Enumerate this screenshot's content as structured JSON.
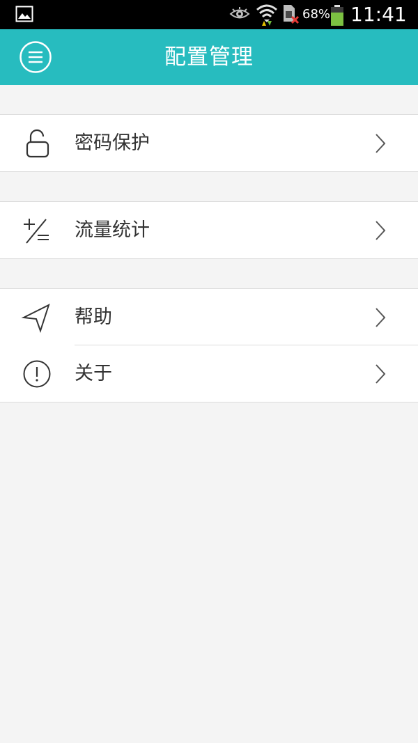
{
  "colors": {
    "accent": "#27bcbf",
    "background": "#f4f4f4",
    "status_bar": "#000000"
  },
  "status_bar": {
    "battery_percent": "68%",
    "time": "11:41",
    "icons": [
      "gallery-icon",
      "eye-icon",
      "wifi-icon",
      "sim-error-icon",
      "battery-icon"
    ]
  },
  "app_bar": {
    "menu_icon": "menu-circle-icon",
    "title": "配置管理"
  },
  "groups": [
    {
      "items": [
        {
          "label": "密码保护",
          "icon": "unlock-icon"
        }
      ]
    },
    {
      "items": [
        {
          "label": "流量统计",
          "icon": "plus-minus-icon"
        }
      ]
    },
    {
      "items": [
        {
          "label": "帮助",
          "icon": "send-arrow-icon"
        },
        {
          "label": "关于",
          "icon": "exclamation-circle-icon"
        }
      ]
    }
  ]
}
